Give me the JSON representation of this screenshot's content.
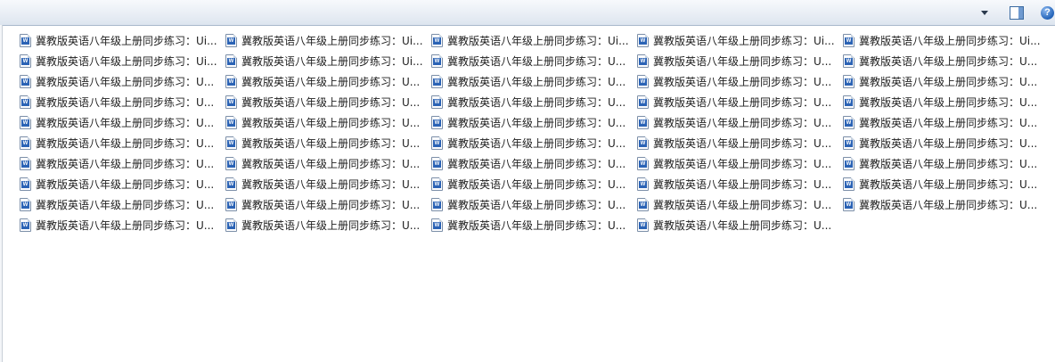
{
  "toolbar": {
    "view_icon": "grid-view-icon",
    "dropdown_icon": "chevron-down-icon",
    "preview_icon": "preview-pane-icon",
    "help_label": "?"
  },
  "files": {
    "icon": "word-document-icon",
    "rows": [
      [
        "冀教版英语八年级上册同步练习：Ui...",
        "冀教版英语八年级上册同步练习：Ui...",
        "冀教版英语八年级上册同步练习：Ui...",
        "冀教版英语八年级上册同步练习：Ui...",
        "冀教版英语八年级上册同步练习：Ui..."
      ],
      [
        "冀教版英语八年级上册同步练习：Ui...",
        "冀教版英语八年级上册同步练习：Ui...",
        "冀教版英语八年级上册同步练习：U...",
        "冀教版英语八年级上册同步练习：U...",
        "冀教版英语八年级上册同步练习：U..."
      ],
      [
        "冀教版英语八年级上册同步练习：U...",
        "冀教版英语八年级上册同步练习：U...",
        "冀教版英语八年级上册同步练习：U...",
        "冀教版英语八年级上册同步练习：U...",
        "冀教版英语八年级上册同步练习：U..."
      ],
      [
        "冀教版英语八年级上册同步练习：U...",
        "冀教版英语八年级上册同步练习：U...",
        "冀教版英语八年级上册同步练习：U...",
        "冀教版英语八年级上册同步练习：U...",
        "冀教版英语八年级上册同步练习：U..."
      ],
      [
        "冀教版英语八年级上册同步练习：U...",
        "冀教版英语八年级上册同步练习：U...",
        "冀教版英语八年级上册同步练习：U...",
        "冀教版英语八年级上册同步练习：U...",
        "冀教版英语八年级上册同步练习：U..."
      ],
      [
        "冀教版英语八年级上册同步练习：U...",
        "冀教版英语八年级上册同步练习：U...",
        "冀教版英语八年级上册同步练习：U...",
        "冀教版英语八年级上册同步练习：U...",
        "冀教版英语八年级上册同步练习：U..."
      ],
      [
        "冀教版英语八年级上册同步练习：U...",
        "冀教版英语八年级上册同步练习：U...",
        "冀教版英语八年级上册同步练习：U...",
        "冀教版英语八年级上册同步练习：U...",
        "冀教版英语八年级上册同步练习：U..."
      ],
      [
        "冀教版英语八年级上册同步练习：U...",
        "冀教版英语八年级上册同步练习：U...",
        "冀教版英语八年级上册同步练习：U...",
        "冀教版英语八年级上册同步练习：U...",
        "冀教版英语八年级上册同步练习：U..."
      ],
      [
        "冀教版英语八年级上册同步练习：U...",
        "冀教版英语八年级上册同步练习：U...",
        "冀教版英语八年级上册同步练习：U...",
        "冀教版英语八年级上册同步练习：U...",
        "冀教版英语八年级上册同步练习：U..."
      ],
      [
        "冀教版英语八年级上册同步练习：U...",
        "冀教版英语八年级上册同步练习：U...",
        "冀教版英语八年级上册同步练习：U...",
        "冀教版英语八年级上册同步练习：U..."
      ]
    ]
  }
}
